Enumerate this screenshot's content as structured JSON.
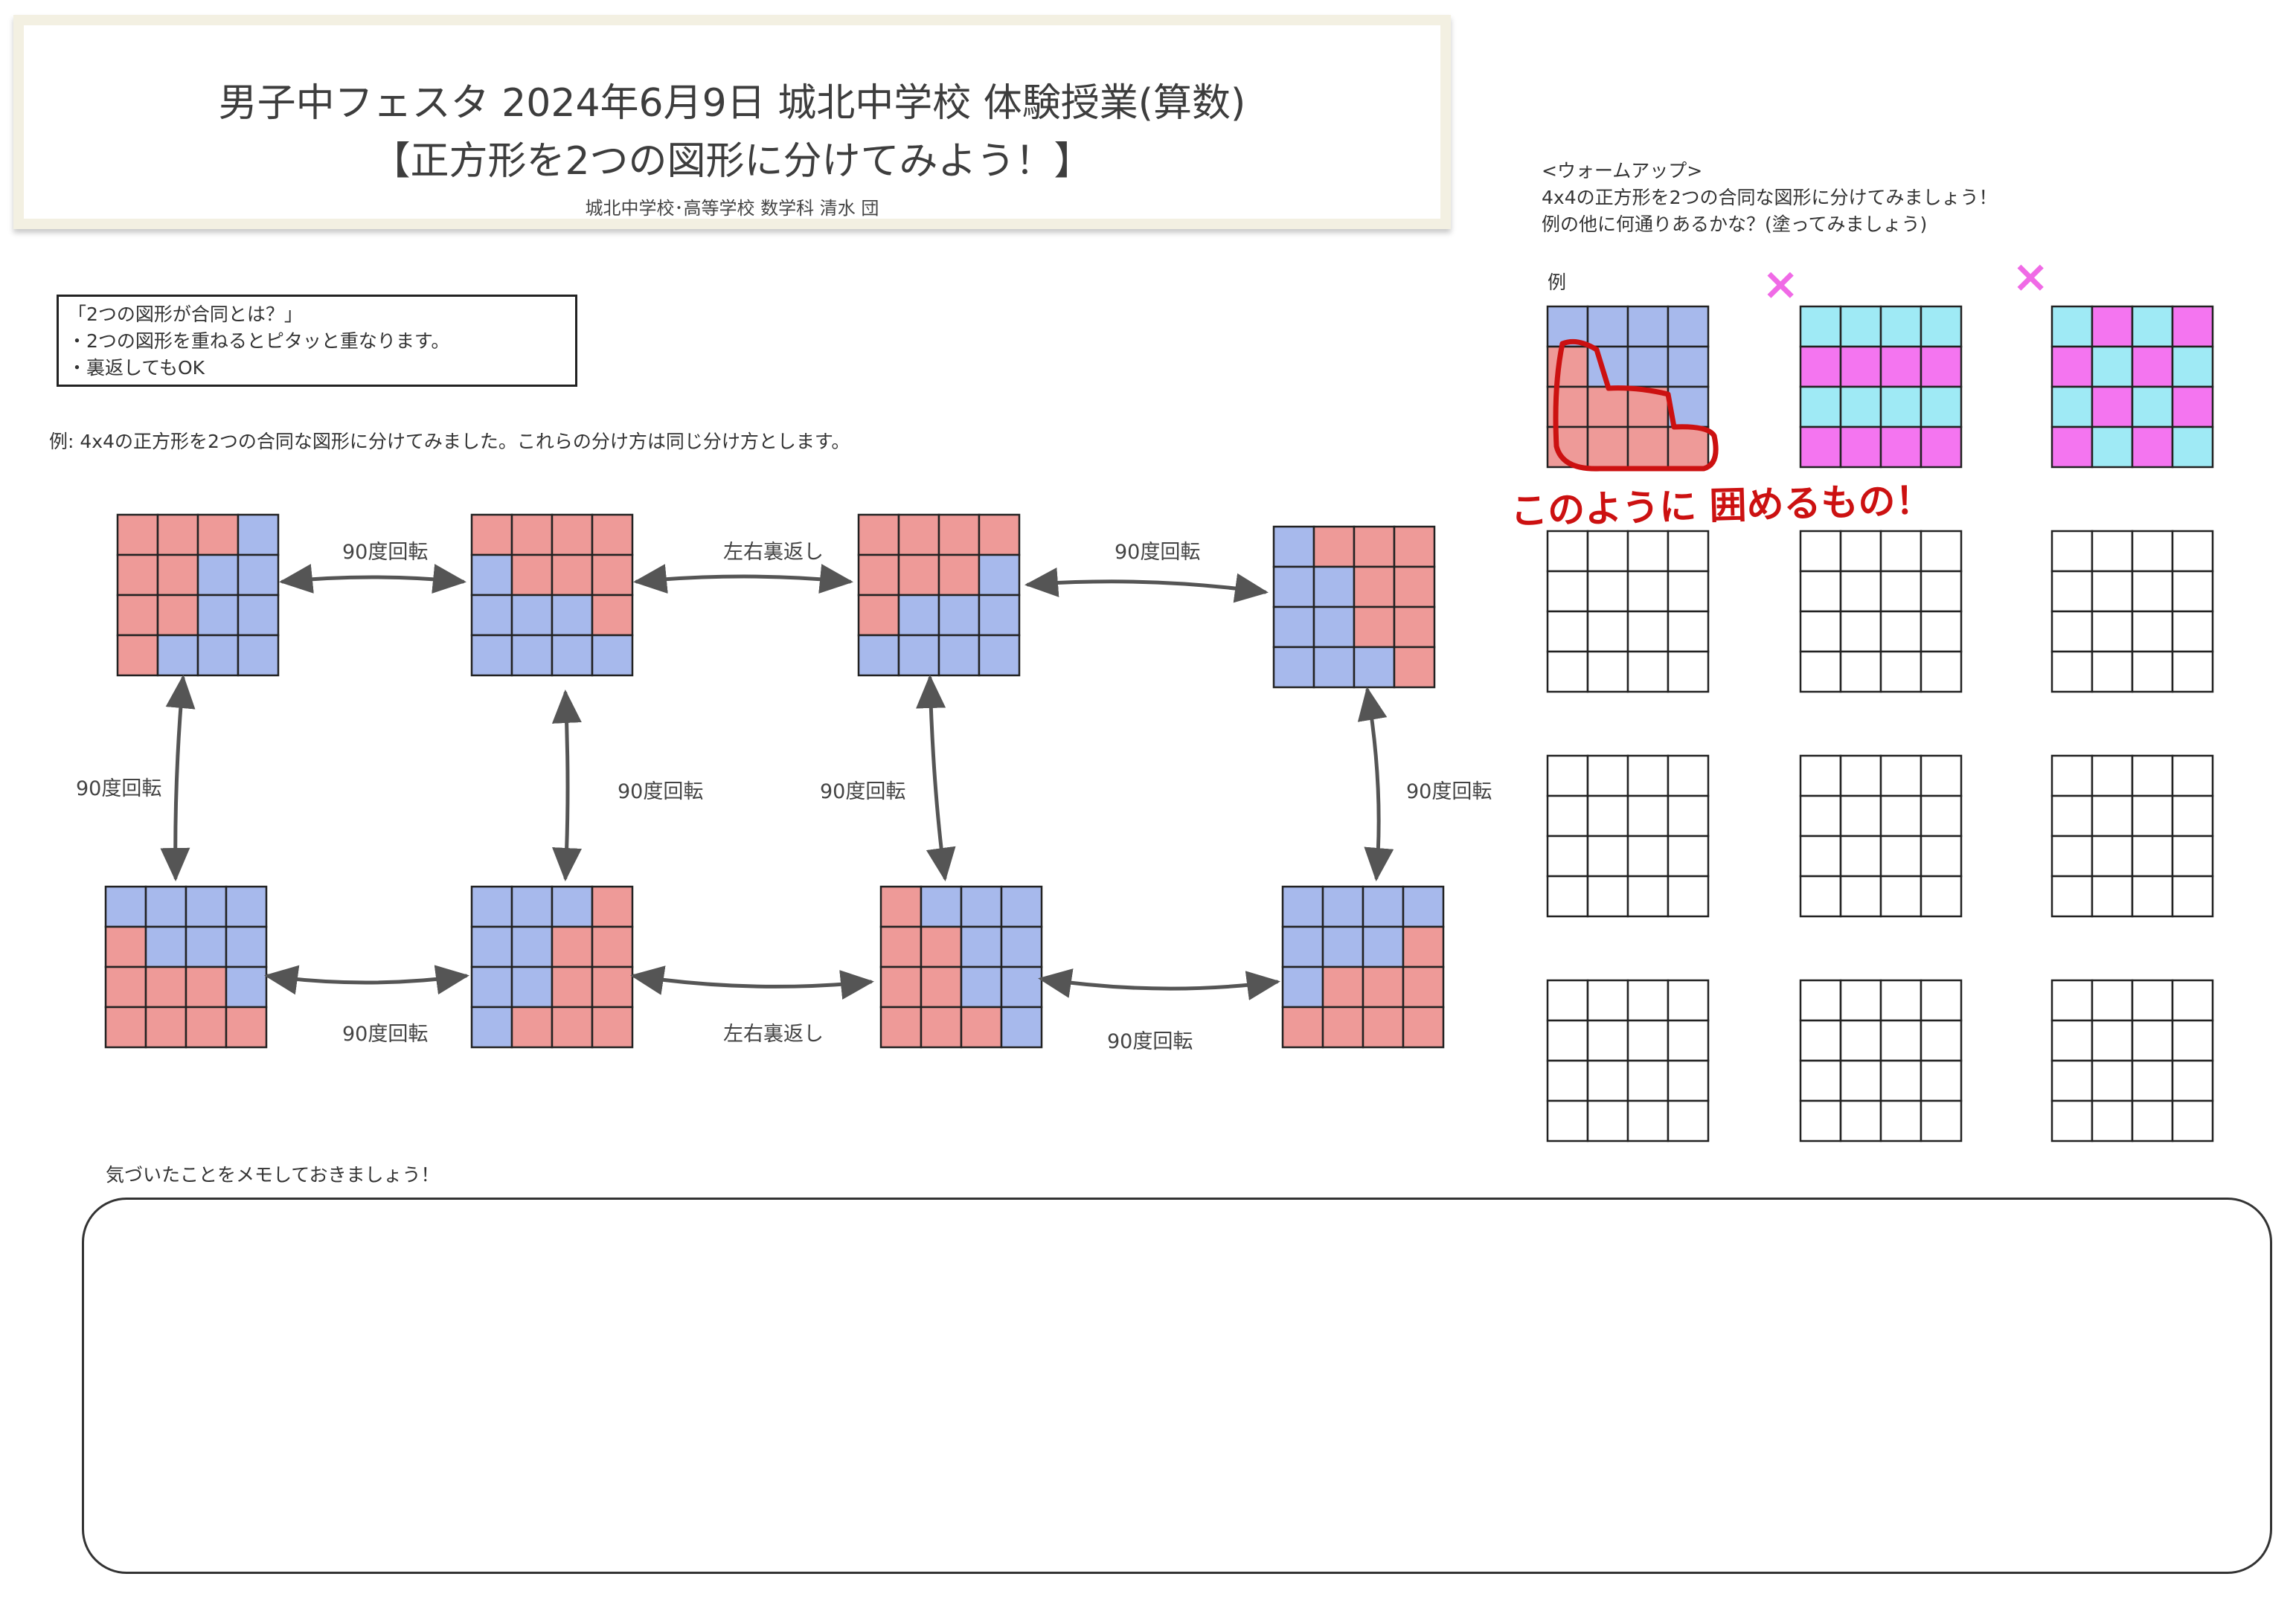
{
  "title": {
    "line1": "男子中フェスタ  2024年6月9日 城北中学校  体験授業(算数)",
    "line2": "【正方形を2つの図形に分けてみよう！】",
    "author": "城北中学校･高等学校  数学科  清水  団"
  },
  "definition": {
    "lines": [
      "「2つの図形が合同とは？」",
      "・2つの図形を重ねるとピタッと重なります。",
      "・裏返してもOK"
    ]
  },
  "example_caption": "例:   4x4の正方形を2つの合同な図形に分けてみました。これらの分け方は同じ分け方とします。",
  "colors": {
    "red": "#ee9a98",
    "blue": "#a7b9ec",
    "cyan": "#9feaf5",
    "magenta": "#f475f0",
    "annotation_red": "#cc1111"
  },
  "examples": [
    [
      "RRRB",
      "RRBB",
      "RRBB",
      "RBBB"
    ],
    [
      "RRRR",
      "BRRR",
      "BBBR",
      "BBBB"
    ],
    [
      "RRRR",
      "RRRB",
      "RBBB",
      "BBBB"
    ],
    [
      "BRRR",
      "BBRR",
      "BBRR",
      "BBBR"
    ],
    [
      "BBBB",
      "RBBB",
      "RRRB",
      "RRRR"
    ],
    [
      "BBBR",
      "BBRR",
      "BBRR",
      "BRRR"
    ],
    [
      "RBBB",
      "RRBB",
      "RRBB",
      "RRRB"
    ],
    [
      "BBBB",
      "BBBR",
      "BRRR",
      "RRRR"
    ]
  ],
  "arrow_labels": {
    "top_1": "90度回転",
    "top_2": "左右裏返し",
    "top_3": "90度回転",
    "v_1": "90度回転",
    "v_2": "90度回転",
    "v_3": "90度回転",
    "v_4": "90度回転",
    "bottom_1": "90度回転",
    "bottom_2": "左右裏返し",
    "bottom_3": "90度回転"
  },
  "warmup": {
    "heading": "<ウォームアップ>",
    "line1": "4x4の正方形を2つの合同な図形に分けてみましょう！",
    "line2": "例の他に何通りあるかな？(塗ってみましょう)",
    "example_label": "例",
    "example_grid": [
      "BBBB",
      "RBBB",
      "RRRB",
      "RRRR"
    ],
    "striped_grid": [
      "CCCC",
      "MMMM",
      "CCCC",
      "MMMM"
    ],
    "checker_grid": [
      "CMCM",
      "MCMC",
      "CMCM",
      "MCMC"
    ],
    "cross_mark": "×",
    "annotation": "このように 囲めるもの！",
    "empty_grid_count": 9
  },
  "memo": {
    "label": "気づいたことをメモしておきましょう！"
  }
}
